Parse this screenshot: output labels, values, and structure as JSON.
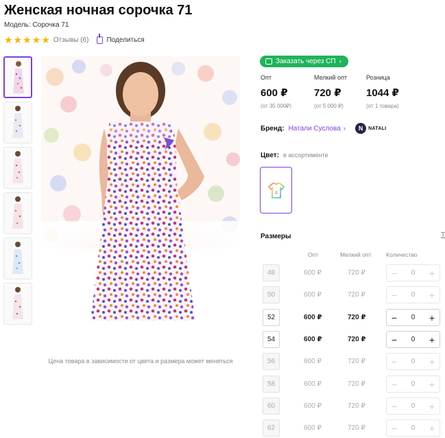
{
  "product": {
    "title": "Женская ночная сорочка 71",
    "model": "Модель: Сорочка 71",
    "rating_stars": 5,
    "reviews": "Отзывы (6)",
    "share": "Поделиться",
    "caption": "Цена товара в зависимости от цвета и размера может меняться"
  },
  "buy": {
    "sp_button": "Заказать через СП",
    "prices": [
      {
        "label": "Опт",
        "value": "600 ₽",
        "sub": "(от 35 000₽)"
      },
      {
        "label": "Мелкий опт",
        "value": "720 ₽",
        "sub": "(от 5 000 ₽)"
      },
      {
        "label": "Розница",
        "value": "1044 ₽",
        "sub": "(от 1 товара)"
      }
    ],
    "brand_label": "Бренд:",
    "brand_name": "Натали Суслова",
    "brand_logo_letter": "N",
    "brand_logo_text": "NATALI",
    "color_label": "Цвет:",
    "color_value": "в ассортименте",
    "color_swatch_letter": "A"
  },
  "sizes": {
    "title": "Размеры",
    "side_mark": "Т",
    "headers": {
      "opt": "Опт",
      "small": "Мелкий опт",
      "qty": "Количество"
    },
    "rows": [
      {
        "size": "48",
        "opt": "600 ₽",
        "small": "720 ₽",
        "qty": "0",
        "available": false
      },
      {
        "size": "50",
        "opt": "600 ₽",
        "small": "720 ₽",
        "qty": "0",
        "available": false
      },
      {
        "size": "52",
        "opt": "600 ₽",
        "small": "720 ₽",
        "qty": "0",
        "available": true
      },
      {
        "size": "54",
        "opt": "600 ₽",
        "small": "720 ₽",
        "qty": "0",
        "available": true
      },
      {
        "size": "56",
        "opt": "600 ₽",
        "small": "720 ₽",
        "qty": "0",
        "available": false
      },
      {
        "size": "58",
        "opt": "600 ₽",
        "small": "720 ₽",
        "qty": "0",
        "available": false
      },
      {
        "size": "60",
        "opt": "600 ₽",
        "small": "720 ₽",
        "qty": "0",
        "available": false
      },
      {
        "size": "62",
        "opt": "600 ₽",
        "small": "720 ₽",
        "qty": "0",
        "available": false
      }
    ]
  },
  "colors": {
    "accent": "#7b3fe4",
    "green": "#1fb35a",
    "star": "#f7b500"
  }
}
